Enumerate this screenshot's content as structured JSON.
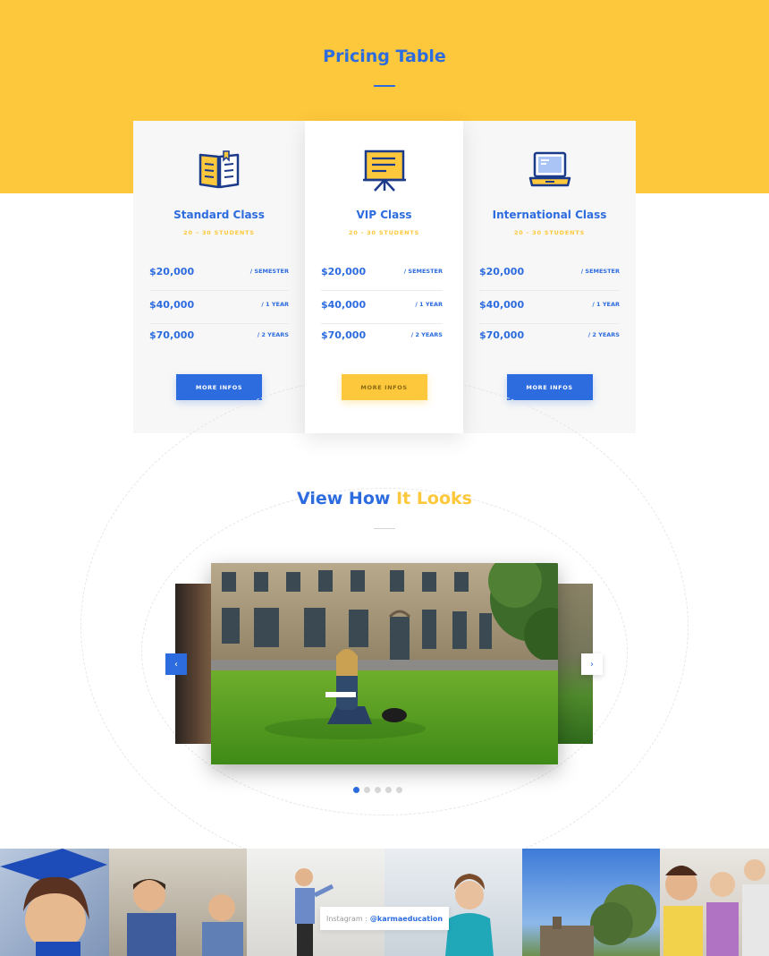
{
  "pricing": {
    "title": "Pricing Table",
    "cards": [
      {
        "name": "Standard Class",
        "students": "20 – 30 STUDENTS",
        "icon": "book-icon",
        "prices": [
          {
            "amount": "$20,000",
            "period": "/ SEMESTER"
          },
          {
            "amount": "$40,000",
            "period": "/ 1 YEAR"
          },
          {
            "amount": "$70,000",
            "period": "/ 2 YEARS"
          }
        ],
        "button": "MORE INFOS"
      },
      {
        "name": "VIP Class",
        "students": "20 - 30 STUDENTS",
        "icon": "presentation-board-icon",
        "prices": [
          {
            "amount": "$20,000",
            "period": "/ SEMESTER"
          },
          {
            "amount": "$40,000",
            "period": "/ 1 YEAR"
          },
          {
            "amount": "$70,000",
            "period": "/ 2 YEARS"
          }
        ],
        "button": "MORE INFOS"
      },
      {
        "name": "International Class",
        "students": "20 - 30 STUDENTS",
        "icon": "laptop-icon",
        "prices": [
          {
            "amount": "$20,000",
            "period": "/ SEMESTER"
          },
          {
            "amount": "$40,000",
            "period": "/ 1 YEAR"
          },
          {
            "amount": "$70,000",
            "period": "/ 2 YEARS"
          }
        ],
        "button": "MORE INFOS"
      }
    ]
  },
  "gallery": {
    "title_part1": "View How",
    "title_part2": "It Looks",
    "prev_icon": "‹",
    "next_icon": "›",
    "active_index": 0,
    "dot_count": 5
  },
  "instagram": {
    "label": "Instagram :",
    "handle": "@karmaeducation"
  },
  "colors": {
    "brand_blue": "#2d6cdf",
    "brand_yellow": "#fdc83c"
  }
}
